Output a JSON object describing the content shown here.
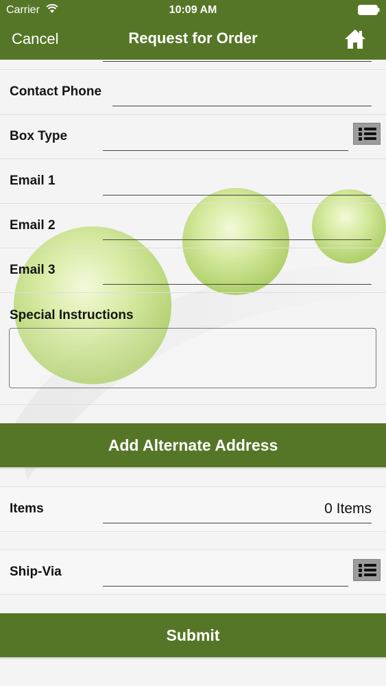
{
  "status_bar": {
    "carrier": "Carrier",
    "time": "10:09 AM"
  },
  "nav": {
    "cancel_label": "Cancel",
    "title": "Request for Order",
    "home_icon": "home-icon"
  },
  "form": {
    "contact_phone": {
      "label": "Contact Phone",
      "value": ""
    },
    "box_type": {
      "label": "Box Type",
      "value": "",
      "picker_icon": "list-icon"
    },
    "email1": {
      "label": "Email 1",
      "value": ""
    },
    "email2": {
      "label": "Email 2",
      "value": ""
    },
    "email3": {
      "label": "Email 3",
      "value": ""
    },
    "special_instructions": {
      "label": "Special Instructions",
      "value": ""
    }
  },
  "buttons": {
    "add_alternate_address": "Add Alternate Address",
    "submit": "Submit"
  },
  "items": {
    "label": "Items",
    "value": "0 Items"
  },
  "ship_via": {
    "label": "Ship-Via",
    "value": "",
    "picker_icon": "list-icon"
  },
  "colors": {
    "brand_green": "#567627",
    "background": "#f4f4f4",
    "decor_sphere": "#c6e27a"
  }
}
